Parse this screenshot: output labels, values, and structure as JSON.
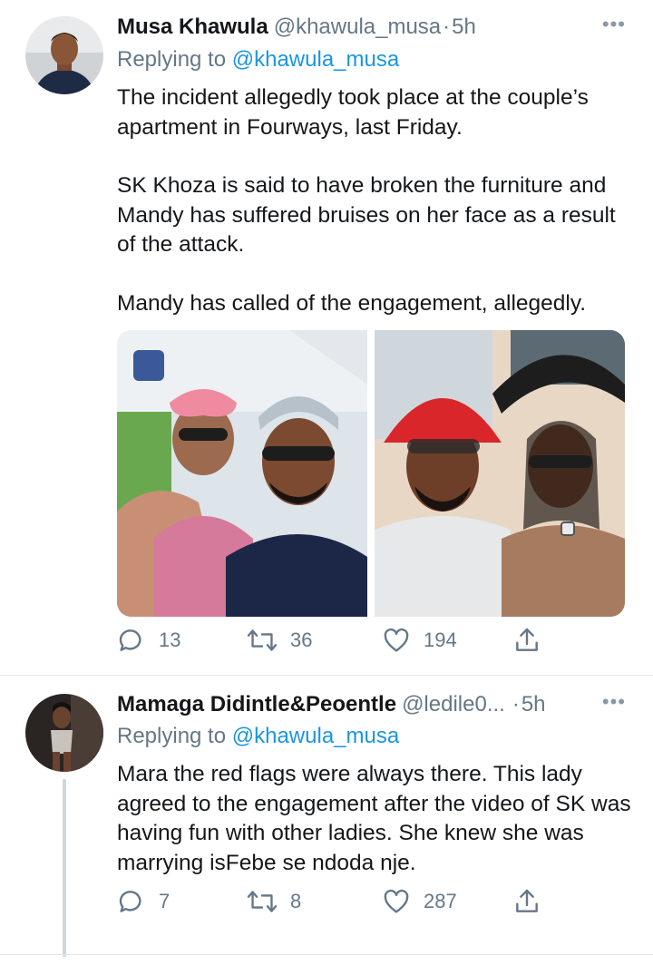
{
  "tweets": [
    {
      "name": "Musa Khawula",
      "handle": "@khawula_musa",
      "dot": "·",
      "time": "5h",
      "more": "•••",
      "replying_prefix": "Replying to",
      "replying_to": "@khawula_musa",
      "paragraphs": [
        "The incident allegedly took place at the couple’s apartment in Fourways, last Friday.",
        "SK Khoza is said to have broken the furniture and Mandy has suffered bruises on her face as a result of the attack.",
        "Mandy has called of the engagement, allegedly."
      ],
      "media": [
        "photo-couple-selfie-outdoor",
        "photo-couple-selfie-red-hat"
      ],
      "stats": {
        "replies": "13",
        "retweets": "36",
        "likes": "194"
      }
    },
    {
      "name": "Mamaga Didintle&Peoentle",
      "handle": "@ledile0...",
      "dot": "·",
      "time": "5h",
      "more": "•••",
      "replying_prefix": "Replying to",
      "replying_to": "@khawula_musa",
      "paragraphs": [
        "Mara the red flags were always there. This lady agreed to the engagement after the video of SK was having fun with other ladies. She knew she was marrying isFebe se ndoda nje."
      ],
      "stats": {
        "replies": "7",
        "retweets": "8",
        "likes": "287"
      }
    }
  ],
  "icons": {
    "reply": "reply-icon",
    "retweet": "retweet-icon",
    "like": "heart-icon",
    "share": "share-icon"
  },
  "colors": {
    "text": "#14171a",
    "secondary": "#657786",
    "link": "#1b95e0",
    "divider": "#e1e8ed"
  }
}
